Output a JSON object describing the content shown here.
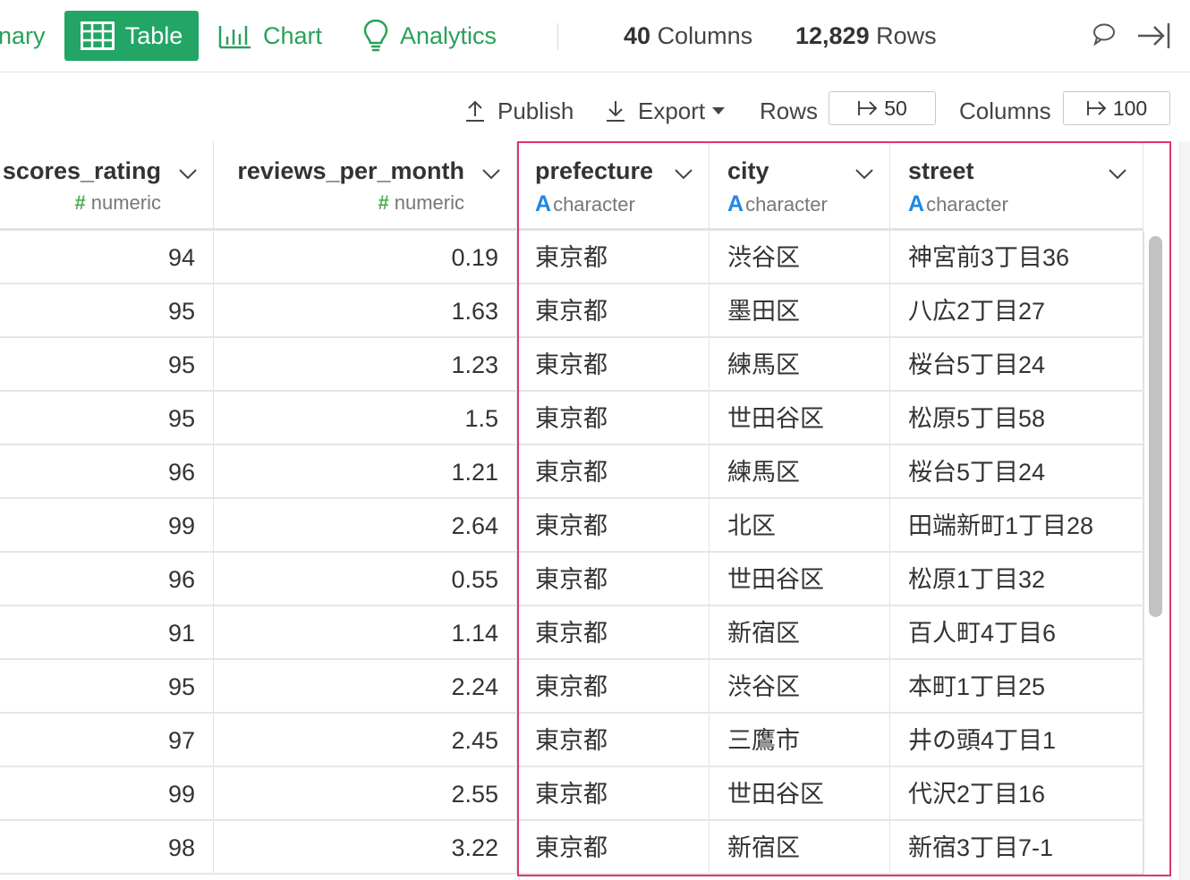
{
  "tabs": {
    "summary": "nary",
    "table": "Table",
    "chart": "Chart",
    "analytics": "Analytics"
  },
  "stats": {
    "columns_count": "40",
    "columns_label": "Columns",
    "rows_count": "12,829",
    "rows_label": "Rows"
  },
  "toolbar": {
    "publish": "Publish",
    "export": "Export",
    "rows_label": "Rows",
    "rows_value": "50",
    "columns_label": "Columns",
    "columns_value": "100"
  },
  "columns": [
    {
      "name": "scores_rating",
      "type": "numeric"
    },
    {
      "name": "reviews_per_month",
      "type": "numeric"
    },
    {
      "name": "prefecture",
      "type": "character"
    },
    {
      "name": "city",
      "type": "character"
    },
    {
      "name": "street",
      "type": "character"
    }
  ],
  "rows": [
    [
      "94",
      "0.19",
      "東京都",
      "渋谷区",
      "神宮前3丁目36"
    ],
    [
      "95",
      "1.63",
      "東京都",
      "墨田区",
      "八広2丁目27"
    ],
    [
      "95",
      "1.23",
      "東京都",
      "練馬区",
      "桜台5丁目24"
    ],
    [
      "95",
      "1.5",
      "東京都",
      "世田谷区",
      "松原5丁目58"
    ],
    [
      "96",
      "1.21",
      "東京都",
      "練馬区",
      "桜台5丁目24"
    ],
    [
      "99",
      "2.64",
      "東京都",
      "北区",
      "田端新町1丁目28"
    ],
    [
      "96",
      "0.55",
      "東京都",
      "世田谷区",
      "松原1丁目32"
    ],
    [
      "91",
      "1.14",
      "東京都",
      "新宿区",
      "百人町4丁目6"
    ],
    [
      "95",
      "2.24",
      "東京都",
      "渋谷区",
      "本町1丁目25"
    ],
    [
      "97",
      "2.45",
      "東京都",
      "三鷹市",
      "井の頭4丁目1"
    ],
    [
      "99",
      "2.55",
      "東京都",
      "世田谷区",
      "代沢2丁目16"
    ],
    [
      "98",
      "3.22",
      "東京都",
      "新宿区",
      "新宿3丁目7-1"
    ]
  ],
  "colors": {
    "accent": "#22a565",
    "highlight": "#e0336e",
    "numeric_icon": "#4caf50",
    "character_icon": "#1e88e5"
  }
}
